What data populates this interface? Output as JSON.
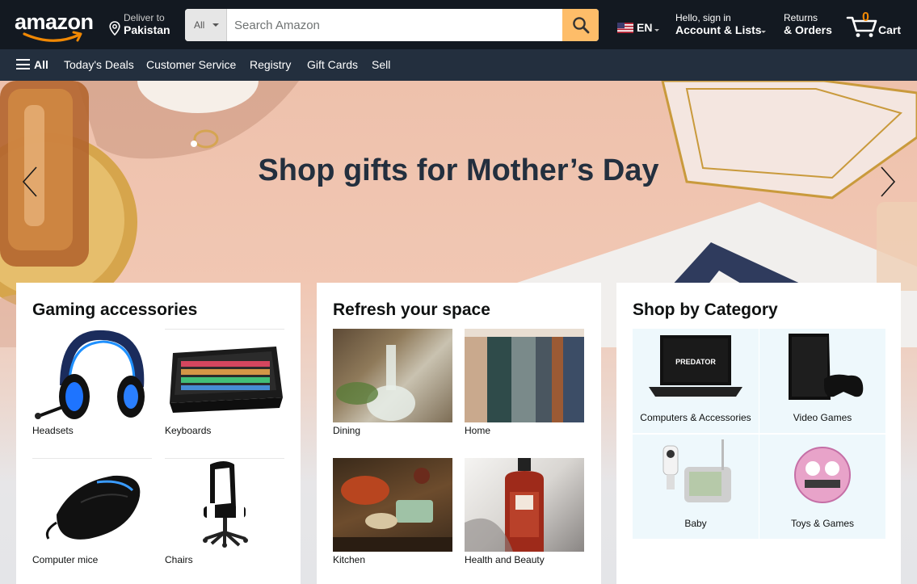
{
  "nav": {
    "logo": "amazon",
    "deliver_label": "Deliver to",
    "deliver_location": "Pakistan",
    "search_category": "All",
    "search_placeholder": "Search Amazon",
    "language": "EN",
    "account_greeting": "Hello, sign in",
    "account_label": "Account & Lists",
    "returns_line1": "Returns",
    "returns_line2": "& Orders",
    "cart_count": "0",
    "cart_label": "Cart"
  },
  "subnav": {
    "all": "All",
    "items": [
      "Today's Deals",
      "Customer Service",
      "Registry",
      "Gift Cards",
      "Sell"
    ]
  },
  "hero": {
    "title": "Shop gifts for Mother’s Day"
  },
  "cards": [
    {
      "title": "Gaming accessories",
      "tiles": [
        "Headsets",
        "Keyboards",
        "Computer mice",
        "Chairs"
      ]
    },
    {
      "title": "Refresh your space",
      "tiles": [
        "Dining",
        "Home",
        "Kitchen",
        "Health and Beauty"
      ]
    },
    {
      "title": "Shop by Category",
      "tiles": [
        "Computers & Accessories",
        "Video Games",
        "Baby",
        "Toys & Games"
      ]
    }
  ],
  "colors": {
    "nav_bg": "#131921",
    "subnav_bg": "#232f3e",
    "search_button": "#febd69",
    "cart_count": "#f08804",
    "category_tile_bg": "#eef8fc"
  },
  "icons": {
    "location": "location-pin-icon",
    "search": "magnifier-icon",
    "cart": "cart-icon",
    "menu": "hamburger-icon",
    "prev": "chevron-left-icon",
    "next": "chevron-right-icon"
  }
}
